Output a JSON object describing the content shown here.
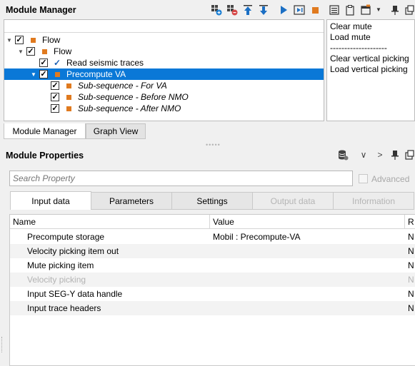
{
  "module_manager": {
    "title": "Module Manager",
    "toolbar_icons": [
      "add-module-icon",
      "remove-module-icon",
      "move-up-icon",
      "move-down-icon",
      "run-icon",
      "run-step-icon",
      "stop-icon",
      "list-icon",
      "clipboard-icon",
      "window-icon",
      "dropdown-icon",
      "pin-icon",
      "detach-icon"
    ],
    "tree": [
      {
        "label": "Flow",
        "level": 0,
        "expanded": true,
        "checked": true,
        "marker": "square",
        "italic": false,
        "selected": false
      },
      {
        "label": "Flow",
        "level": 1,
        "expanded": true,
        "checked": true,
        "marker": "square",
        "italic": false,
        "selected": false
      },
      {
        "label": "Read seismic traces",
        "level": 2,
        "expanded": null,
        "checked": true,
        "marker": "check",
        "italic": false,
        "selected": false
      },
      {
        "label": "Precompute VA",
        "level": 2,
        "expanded": true,
        "checked": true,
        "marker": "square",
        "italic": false,
        "selected": true
      },
      {
        "label": "Sub-sequence - For VA",
        "level": 3,
        "expanded": null,
        "checked": true,
        "marker": "square",
        "italic": true,
        "selected": false
      },
      {
        "label": "Sub-sequence - Before NMO",
        "level": 3,
        "expanded": null,
        "checked": true,
        "marker": "square",
        "italic": true,
        "selected": false
      },
      {
        "label": "Sub-sequence - After NMO",
        "level": 3,
        "expanded": null,
        "checked": true,
        "marker": "square",
        "italic": true,
        "selected": false
      }
    ],
    "side_list": [
      "Clear mute",
      "Load mute",
      "--------------------",
      "Clear vertical picking",
      "Load vertical picking"
    ],
    "tabs": [
      {
        "label": "Module Manager",
        "active": true
      },
      {
        "label": "Graph View",
        "active": false
      }
    ]
  },
  "module_properties": {
    "title": "Module Properties",
    "toolbar_icons": [
      "database-icon",
      "chevron-down-icon",
      "chevron-right-icon",
      "pin-icon",
      "detach-icon"
    ],
    "search": {
      "placeholder": "Search Property",
      "value": ""
    },
    "advanced_label": "Advanced",
    "tabs": [
      {
        "label": "Input data",
        "state": "active"
      },
      {
        "label": "Parameters",
        "state": "inactive"
      },
      {
        "label": "Settings",
        "state": "inactive"
      },
      {
        "label": "Output data",
        "state": "disabled"
      },
      {
        "label": "Information",
        "state": "disabled"
      }
    ],
    "columns": [
      "Name",
      "Value",
      "R"
    ],
    "rows": [
      {
        "name": "Precompute storage",
        "value": "Mobil : Precompute-VA",
        "r": "N",
        "dim": false
      },
      {
        "name": "Velocity picking item out",
        "value": "",
        "r": "N",
        "dim": false
      },
      {
        "name": "Mute picking item",
        "value": "",
        "r": "N",
        "dim": false
      },
      {
        "name": "Velocity picking",
        "value": "",
        "r": "N",
        "dim": true
      },
      {
        "name": "Input SEG-Y data handle",
        "value": "",
        "r": "N",
        "dim": false
      },
      {
        "name": "Input trace headers",
        "value": "",
        "r": "N",
        "dim": false
      }
    ]
  }
}
